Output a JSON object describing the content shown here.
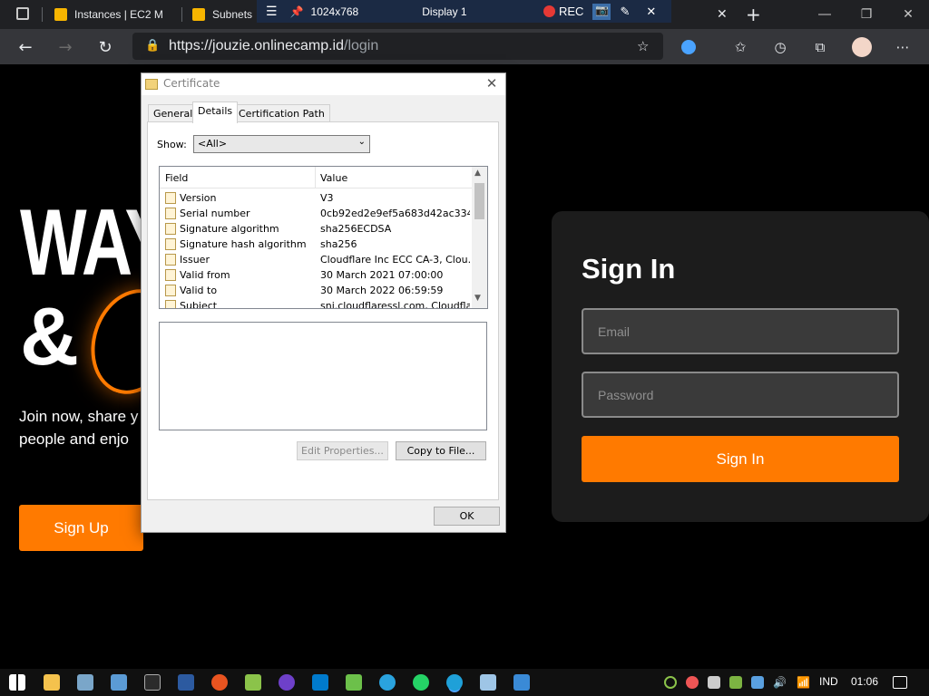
{
  "browser": {
    "tabs": [
      {
        "label": "Instances | EC2 M"
      },
      {
        "label": "Subnets"
      }
    ],
    "overlay": {
      "resolution": "1024x768",
      "display": "Display 1",
      "rec": "REC"
    },
    "url_host": "https://jouzie.onlinecamp.id",
    "url_path": "/login"
  },
  "page": {
    "hero_line1": "WAY",
    "hero_line2": "&",
    "hero_text_line1": "Join now, share y",
    "hero_text_line2": "people and enjo",
    "signup_label": "Sign Up",
    "signin_title": "Sign In",
    "email_placeholder": "Email",
    "password_placeholder": "Password",
    "signin_label": "Sign In"
  },
  "dialog": {
    "title": "Certificate",
    "tabs": [
      "General",
      "Details",
      "Certification Path"
    ],
    "show_label": "Show:",
    "show_value": "<All>",
    "col_field": "Field",
    "col_value": "Value",
    "rows": [
      {
        "field": "Version",
        "value": "V3"
      },
      {
        "field": "Serial number",
        "value": "0cb92ed2e9ef5a683d42ac334..."
      },
      {
        "field": "Signature algorithm",
        "value": "sha256ECDSA"
      },
      {
        "field": "Signature hash algorithm",
        "value": "sha256"
      },
      {
        "field": "Issuer",
        "value": "Cloudflare Inc ECC CA-3, Clou..."
      },
      {
        "field": "Valid from",
        "value": "30 March 2021 07:00:00"
      },
      {
        "field": "Valid to",
        "value": "30 March 2022 06:59:59"
      },
      {
        "field": "Subject",
        "value": "sni.cloudflaressl.com, Cloudfla..."
      }
    ],
    "edit_properties": "Edit Properties...",
    "copy_to_file": "Copy to File...",
    "ok": "OK"
  },
  "taskbar": {
    "lang": "IND",
    "time": "01:06"
  },
  "colors": {
    "accent": "#ff7a00",
    "card": "#1c1c1c"
  }
}
